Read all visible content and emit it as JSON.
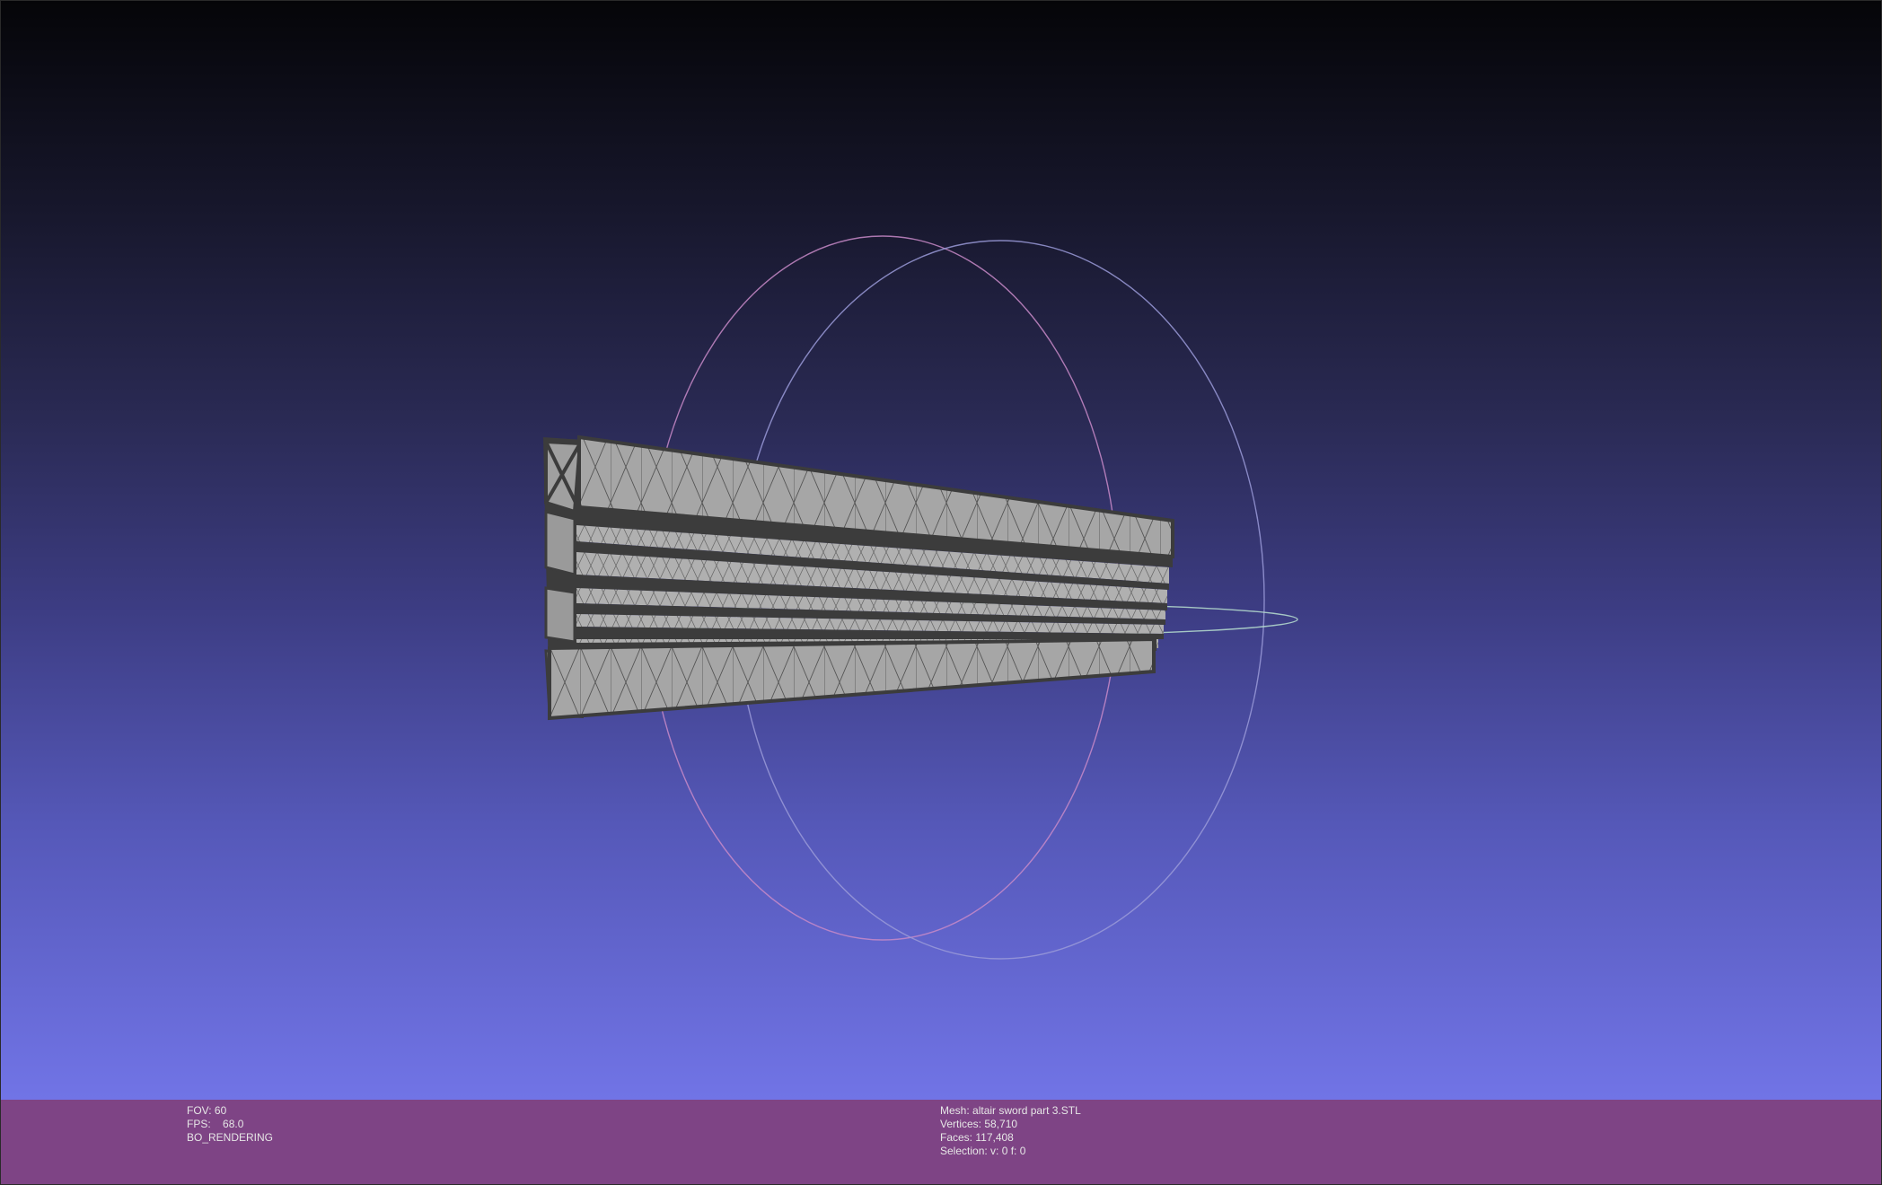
{
  "viewer": {
    "stats_left": {
      "fov_label": "FOV:",
      "fov_value": "60",
      "fps_label": "FPS:",
      "fps_value": "68.0",
      "render_mode": "BO_RENDERING"
    },
    "stats_right": {
      "mesh_label": "Mesh:",
      "mesh_name": "altair sword part 3.STL",
      "vertices_label": "Vertices:",
      "vertices_value": "58,710",
      "faces_label": "Faces:",
      "faces_value": "117,408",
      "selection_label": "Selection:",
      "selection_value": "v: 0 f: 0"
    }
  },
  "colors": {
    "background_top": "#050508",
    "background_bottom": "#7174e6",
    "info_bar": "#7e4485",
    "mesh_face": "#a6a6a6",
    "mesh_edge": "#3c3c3c",
    "trackball_x": "#c88ac8",
    "trackball_y": "#9a9ad8",
    "trackball_z": "#b8e0d0"
  },
  "icons": [
    "trackball-gizmo-icon"
  ]
}
